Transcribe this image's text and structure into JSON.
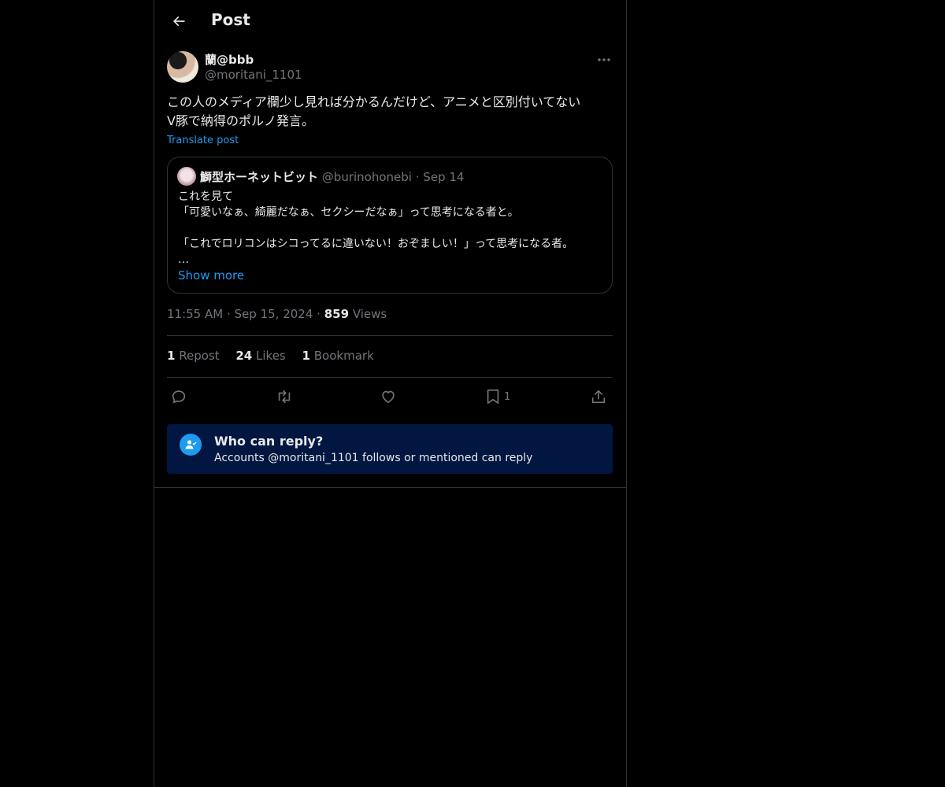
{
  "header": {
    "title": "Post",
    "back_icon": "arrow-left-icon"
  },
  "author": {
    "name": "蘭@bbb",
    "handle": "@moritani_1101"
  },
  "post": {
    "text": "この人のメディア欄少し見れば分かるんだけど、アニメと区別付いてない\nV豚で納得のポルノ発言。",
    "translate": "Translate post"
  },
  "quote": {
    "name": "鰤型ホーネットビット",
    "handle": "@burinohonebi",
    "dot": "·",
    "date": "Sep 14",
    "text": "これを見て\n「可愛いなぁ、綺麗だなぁ、セクシーだなぁ」って思考になる者と。\n\n「これでロリコンはシコってるに違いない！おぞましい！」って思考になる者。\n…",
    "show_more": "Show more"
  },
  "meta": {
    "time": "11:55 AM",
    "dot1": "·",
    "date": "Sep 15, 2024",
    "dot2": "·",
    "views_count": "859",
    "views_label": "Views"
  },
  "stats": {
    "reposts_count": "1",
    "reposts_label": "Repost",
    "likes_count": "24",
    "likes_label": "Likes",
    "bookmarks_count": "1",
    "bookmarks_label": "Bookmark"
  },
  "actions": {
    "bookmark_count": "1"
  },
  "reply_restriction": {
    "title": "Who can reply?",
    "subtitle": "Accounts @moritani_1101 follows or mentioned can reply"
  },
  "colors": {
    "accent": "#1d9bf0",
    "background": "#000000",
    "muted": "#71767b",
    "banner": "#011640"
  }
}
